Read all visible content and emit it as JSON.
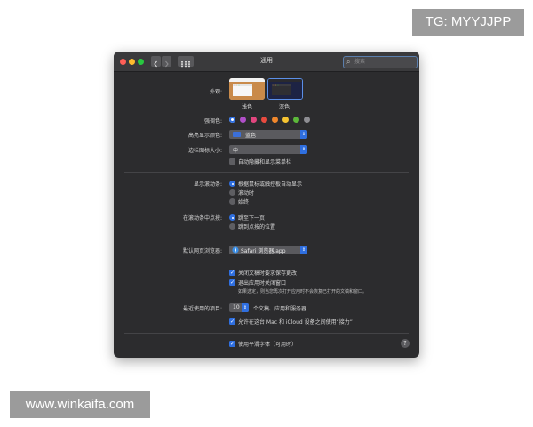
{
  "watermarks": {
    "tg": "TG: MYYJJPP",
    "site": "www.winkaifa.com"
  },
  "window": {
    "title": "通用",
    "search_placeholder": "搜索",
    "icons": {
      "back": "chevron-left-icon",
      "forward": "chevron-right-icon",
      "grid": "grid-icon",
      "search": "search-icon"
    }
  },
  "appearance": {
    "label": "外观:",
    "options": [
      {
        "label": "浅色",
        "selected": false
      },
      {
        "label": "深色",
        "selected": true
      }
    ]
  },
  "accent": {
    "label": "强调色:",
    "colors": [
      "#2f6fe0",
      "#b04fc9",
      "#e2467f",
      "#e84a3f",
      "#f0872c",
      "#f5c331",
      "#5cb83a",
      "#8e8e93"
    ],
    "selected_index": 0
  },
  "highlight": {
    "label": "高亮显示颜色:",
    "value": "蓝色"
  },
  "sidebar_icon": {
    "label": "边栏图标大小:",
    "value": "中"
  },
  "auto_hide_menu": {
    "label": "自动隐藏和显示菜单栏",
    "checked": false
  },
  "show_scrollbars": {
    "label": "显示滚动条:",
    "options": [
      {
        "label": "根据鼠标或触控板自动显示",
        "selected": true
      },
      {
        "label": "滚动时",
        "selected": false
      },
      {
        "label": "始终",
        "selected": false
      }
    ]
  },
  "click_scrollbar": {
    "label": "在滚动条中点按:",
    "options": [
      {
        "label": "跳至下一页",
        "selected": true
      },
      {
        "label": "跳到点按的位置",
        "selected": false
      }
    ]
  },
  "default_browser": {
    "label": "默认网页浏览器:",
    "value": "Safari 浏览器.app"
  },
  "documents": {
    "ask_keep_changes": {
      "label": "关闭文稿时要求保存更改",
      "checked": true
    },
    "close_windows": {
      "label": "退出应用时关闭窗口",
      "checked": true
    },
    "note": "如果选定，则当您再次打开应用时不会恢复已打开的文稿和窗口。"
  },
  "recent_items": {
    "label": "最近使用的项目:",
    "value": "10",
    "suffix": "个文稿、应用和服务器"
  },
  "handoff": {
    "label": "允许在这台 Mac 和 iCloud 设备之间使用“接力”",
    "checked": true
  },
  "font_smoothing": {
    "label": "使用平滑字体（可用时）",
    "checked": true
  },
  "help": "?"
}
